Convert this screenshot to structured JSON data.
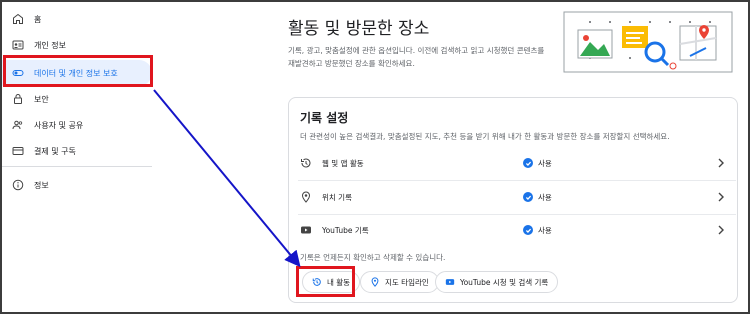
{
  "sidebar": {
    "items": [
      {
        "label": "홈",
        "icon": "home-icon"
      },
      {
        "label": "개인 정보",
        "icon": "id-card-icon"
      },
      {
        "label": "데이터 및 개인 정보 보호",
        "icon": "toggle-icon"
      },
      {
        "label": "보안",
        "icon": "lock-icon"
      },
      {
        "label": "사용자 및 공유",
        "icon": "people-icon"
      },
      {
        "label": "결제 및 구독",
        "icon": "credit-card-icon"
      },
      {
        "label": "정보",
        "icon": "info-icon"
      }
    ],
    "active_index": 2
  },
  "main": {
    "title": "활동 및 방문한 장소",
    "description": "기록, 광고, 맞춤설정에 관한 옵션입니다. 이전에 검색하고 읽고 시청했던 콘텐츠를 재발견하고 방문했던 장소를 확인하세요."
  },
  "card": {
    "title": "기록 설정",
    "description": "더 관련성이 높은 검색결과, 맞춤설정된 지도, 추천 등을 받기 위해 내가 한 활동과 방문한 장소를 저장할지 선택하세요.",
    "rows": [
      {
        "label": "웹 및 앱 활동",
        "status": "사용",
        "icon": "history-icon"
      },
      {
        "label": "위치 기록",
        "status": "사용",
        "icon": "location-pin-icon"
      },
      {
        "label": "YouTube 기록",
        "status": "사용",
        "icon": "youtube-icon"
      }
    ],
    "hint": "기록은 언제든지 확인하고 삭제할 수 있습니다.",
    "chips": [
      {
        "label": "내 활동",
        "icon": "history-icon"
      },
      {
        "label": "지도 타임라인",
        "icon": "location-pin-icon"
      },
      {
        "label": "YouTube 시청 및 검색 기록",
        "icon": "youtube-icon"
      }
    ]
  },
  "colors": {
    "accent": "#1a73e8",
    "active_bg": "#e8f0fe",
    "highlight": "#e0161e",
    "arrow": "#1515c8"
  }
}
